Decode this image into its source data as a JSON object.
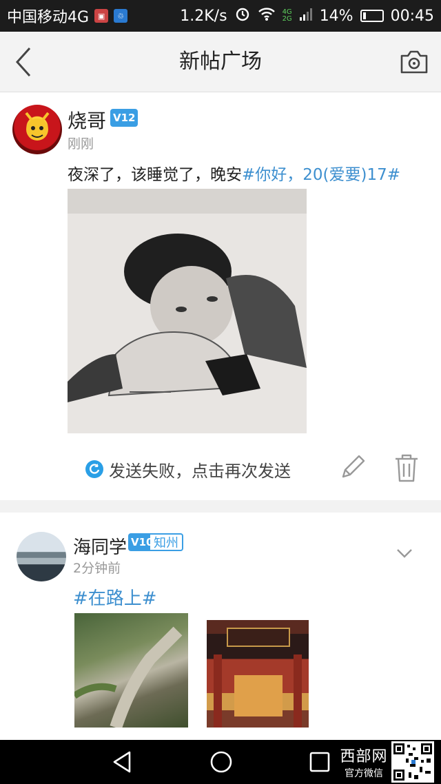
{
  "status_bar": {
    "carrier": "中国移动4G",
    "speed": "1.2K/s",
    "net_top": "4G",
    "net_bottom": "2G",
    "battery": "14%",
    "battery_level": 0.14,
    "time": "00:45"
  },
  "header": {
    "title": "新帖广场",
    "back_icon": "chevron-left-icon",
    "camera_icon": "camera-icon"
  },
  "posts": [
    {
      "username": "烧哥",
      "level": "V12",
      "timestamp": "刚刚",
      "text": "夜深了，该睡觉了，晚安",
      "hashtag": "#你好，20(爱要)17#",
      "status": "发送失败，点击再次发送"
    },
    {
      "username": "海同学",
      "level": "V10",
      "location": "知州",
      "timestamp": "2分钟前",
      "hashtag": "#在路上#"
    }
  ],
  "watermark": {
    "title": "西部网",
    "subtitle": "官方微信"
  },
  "colors": {
    "accent": "#3d8fcf",
    "badge": "#3a9ee4",
    "retry": "#2a9fe6"
  }
}
